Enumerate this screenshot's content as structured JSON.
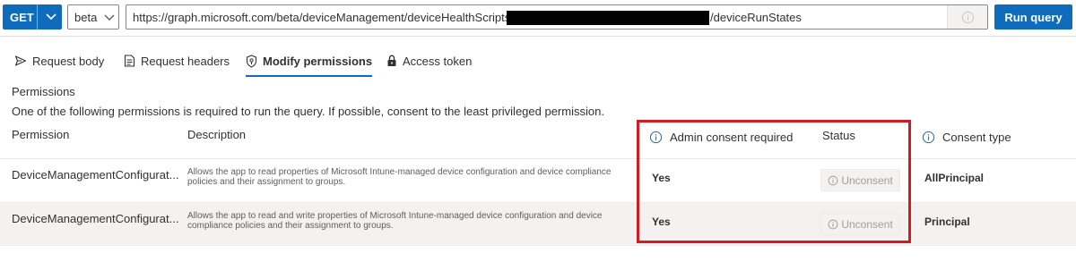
{
  "query_bar": {
    "method": "GET",
    "version": "beta",
    "url_prefix": "https://graph.microsoft.com/beta/deviceManagement/deviceHealthScripts/",
    "url_suffix": "/deviceRunStates",
    "run_label": "Run query",
    "accent": "#0f6cbd"
  },
  "tabs": [
    {
      "label": "Request body",
      "icon": "send-icon"
    },
    {
      "label": "Request headers",
      "icon": "document-icon"
    },
    {
      "label": "Modify permissions",
      "icon": "shield-key-icon",
      "active": true
    },
    {
      "label": "Access token",
      "icon": "lock-icon"
    }
  ],
  "permissions": {
    "title": "Permissions",
    "subtitle": "One of the following permissions is required to run the query. If possible, consent to the least privileged permission.",
    "columns": {
      "permission": "Permission",
      "description": "Description",
      "admin": "Admin consent required",
      "status": "Status",
      "consent_type": "Consent type"
    },
    "rows": [
      {
        "permission": "DeviceManagementConfigurat...",
        "description": "Allows the app to read properties of Microsoft Intune-managed device configuration and device compliance policies and their assignment to groups.",
        "admin": "Yes",
        "status": "Unconsent",
        "consent_type": "AllPrincipal"
      },
      {
        "permission": "DeviceManagementConfigurat...",
        "description": "Allows the app to read and write properties of Microsoft Intune-managed device configuration and device compliance policies and their assignment to groups.",
        "admin": "Yes",
        "status": "Unconsent",
        "consent_type": "Principal"
      }
    ],
    "highlight_color": "#d21c24"
  }
}
